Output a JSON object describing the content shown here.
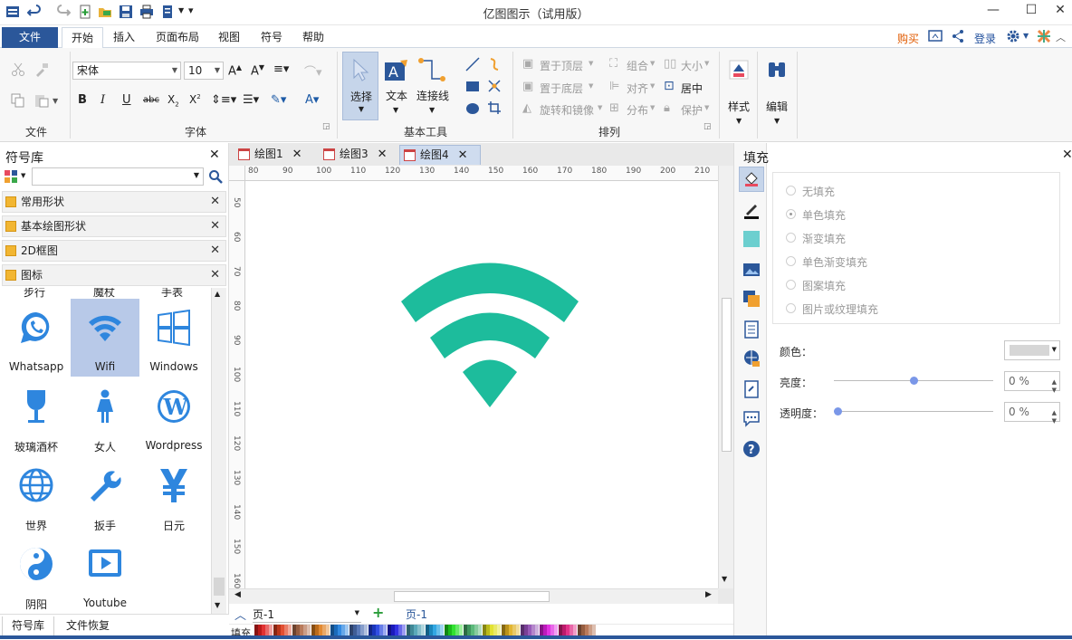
{
  "window": {
    "title": "亿图图示（试用版）"
  },
  "menu": {
    "file": "文件",
    "tabs": [
      "开始",
      "插入",
      "页面布局",
      "视图",
      "符号",
      "帮助"
    ],
    "buy": "购买",
    "login": "登录"
  },
  "ribbon": {
    "font_name": "宋体",
    "font_size": "10",
    "groups": {
      "file": "文件",
      "font": "字体",
      "basic_tools": "基本工具",
      "arrange": "排列"
    },
    "tools": {
      "select": "选择",
      "text": "文本",
      "connector": "连接线"
    },
    "arrange": {
      "bring_front": "置于顶层",
      "send_back": "置于底层",
      "rotate_mirror": "旋转和镜像",
      "group": "组合",
      "align": "对齐",
      "distribute": "分布",
      "size": "大小",
      "center": "居中",
      "protect": "保护"
    },
    "style": "样式",
    "edit": "编辑"
  },
  "library": {
    "title": "符号库",
    "search_placeholder": "",
    "categories": [
      "常用形状",
      "基本绘图形状",
      "2D框图",
      "图标"
    ],
    "partial_row": [
      "步行",
      "魔杖",
      "手表"
    ],
    "symbols": [
      "Whatsapp",
      "Wifi",
      "Windows",
      "玻璃酒杯",
      "女人",
      "Wordpress",
      "世界",
      "扳手",
      "日元",
      "阴阳",
      "Youtube"
    ],
    "selected": "Wifi",
    "bottom_tabs": [
      "符号库",
      "文件恢复"
    ]
  },
  "document": {
    "tabs": [
      "绘图1",
      "绘图3",
      "绘图4"
    ],
    "active_tab": "绘图4",
    "ruler_h": [
      "80",
      "90",
      "100",
      "110",
      "120",
      "130",
      "140",
      "150",
      "160",
      "170",
      "180",
      "190",
      "200",
      "210"
    ],
    "ruler_v": [
      "50",
      "60",
      "70",
      "80",
      "90",
      "100",
      "110",
      "120",
      "130",
      "140",
      "150",
      "160"
    ],
    "page_selector": "页-1",
    "page_tab": "页-1",
    "fill_label": "填充",
    "shape_color": "#1dbc9c"
  },
  "fill_panel": {
    "title": "填充",
    "options": [
      "无填充",
      "单色填充",
      "渐变填充",
      "单色渐变填充",
      "图案填充",
      "图片或纹理填充"
    ],
    "selected": "单色填充",
    "color_label": "颜色：",
    "brightness_label": "亮度：",
    "brightness_value": "0 %",
    "brightness_level": 0.5,
    "transparency_label": "透明度：",
    "transparency_value": "0 %",
    "transparency_level": 0
  },
  "colors": {
    "accent": "#2b579a",
    "icon_blue": "#2e86de",
    "wifi_green": "#1dbc9c"
  }
}
